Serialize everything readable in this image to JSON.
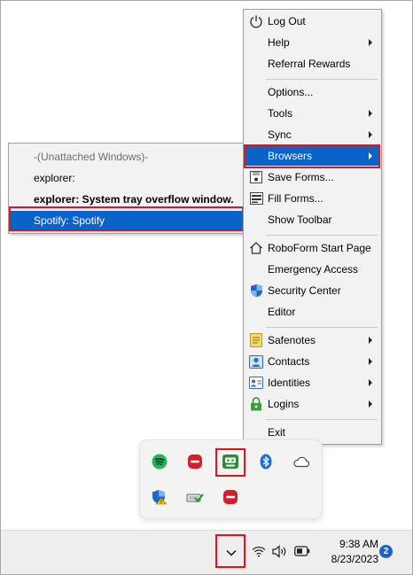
{
  "menu": {
    "items": [
      {
        "label": "Log Out",
        "icon": "power-icon"
      },
      {
        "label": "Help",
        "submenu": true
      },
      {
        "label": "Referral Rewards"
      },
      {
        "label": "Options..."
      },
      {
        "label": "Tools",
        "submenu": true
      },
      {
        "label": "Sync",
        "submenu": true
      },
      {
        "label": "Browsers",
        "submenu": true,
        "selected": true
      },
      {
        "label": "Save Forms...",
        "icon": "save-forms-icon"
      },
      {
        "label": "Fill Forms...",
        "icon": "fill-forms-icon"
      },
      {
        "label": "Show Toolbar"
      },
      {
        "label": "RoboForm Start Page",
        "icon": "home-icon"
      },
      {
        "label": "Emergency Access"
      },
      {
        "label": "Security Center",
        "icon": "shield-icon"
      },
      {
        "label": "Editor"
      },
      {
        "label": "Safenotes",
        "submenu": true,
        "icon": "safenote-icon"
      },
      {
        "label": "Contacts",
        "submenu": true,
        "icon": "contact-icon"
      },
      {
        "label": "Identities",
        "submenu": true,
        "icon": "identity-icon"
      },
      {
        "label": "Logins",
        "submenu": true,
        "icon": "lock-icon"
      },
      {
        "label": "Exit"
      }
    ]
  },
  "submenu": {
    "items": [
      {
        "label": "-(Unattached Windows)-",
        "style": "dim"
      },
      {
        "label": "explorer:",
        "style": "normal"
      },
      {
        "label": "explorer: System tray overflow window.",
        "style": "bold"
      },
      {
        "label": "Spotify: Spotify",
        "style": "selected"
      }
    ]
  },
  "tray": {
    "icons": [
      "spotify-icon",
      "red-app-icon",
      "roboform-icon",
      "bluetooth-icon",
      "onedrive-icon",
      "defender-icon",
      "usb-icon",
      "red-app-icon"
    ]
  },
  "taskbar": {
    "time": "9:38 AM",
    "date": "8/23/2023",
    "notifications": "2"
  },
  "colors": {
    "highlight": "#0a63c9",
    "annotation": "#e0141e",
    "menu_bg": "#f2f2f2"
  }
}
